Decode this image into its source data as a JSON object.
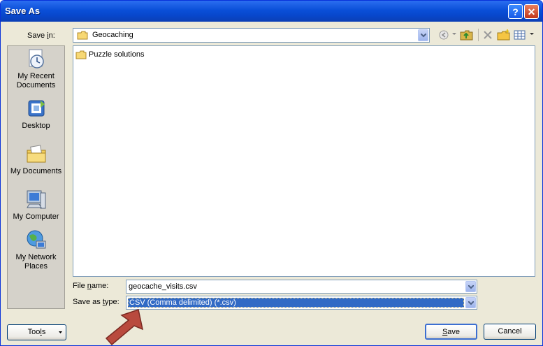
{
  "window": {
    "title": "Save As"
  },
  "title_buttons": {
    "help": "?",
    "close": "✕"
  },
  "save_in": {
    "label_prefix": "Save ",
    "label_accel": "i",
    "label_suffix": "n:",
    "value": "Geocaching"
  },
  "places": [
    {
      "label_line1": "My Recent",
      "label_line2": "Documents",
      "icon": "recent-documents-icon"
    },
    {
      "label_line1": "Desktop",
      "label_line2": "",
      "icon": "desktop-icon"
    },
    {
      "label_line1": "My Documents",
      "label_line2": "",
      "icon": "my-documents-icon"
    },
    {
      "label_line1": "My Computer",
      "label_line2": "",
      "icon": "my-computer-icon"
    },
    {
      "label_line1": "My Network",
      "label_line2": "Places",
      "icon": "network-places-icon"
    }
  ],
  "files": [
    {
      "name": "Puzzle solutions",
      "type": "folder"
    }
  ],
  "file_name": {
    "label_prefix": "File ",
    "label_accel": "n",
    "label_suffix": "ame:",
    "value": "geocache_visits.csv"
  },
  "save_type": {
    "label_prefix": "Save as ",
    "label_accel": "t",
    "label_suffix": "ype:",
    "value": "CSV (Comma delimited) (*.csv)"
  },
  "buttons": {
    "tools_prefix": "Too",
    "tools_accel": "l",
    "tools_suffix": "s",
    "save_accel": "S",
    "save_suffix": "ave",
    "cancel": "Cancel"
  },
  "colors": {
    "arrow": "#b94a3e",
    "selection": "#316ac5",
    "titlebar": "#0a4fd8"
  }
}
